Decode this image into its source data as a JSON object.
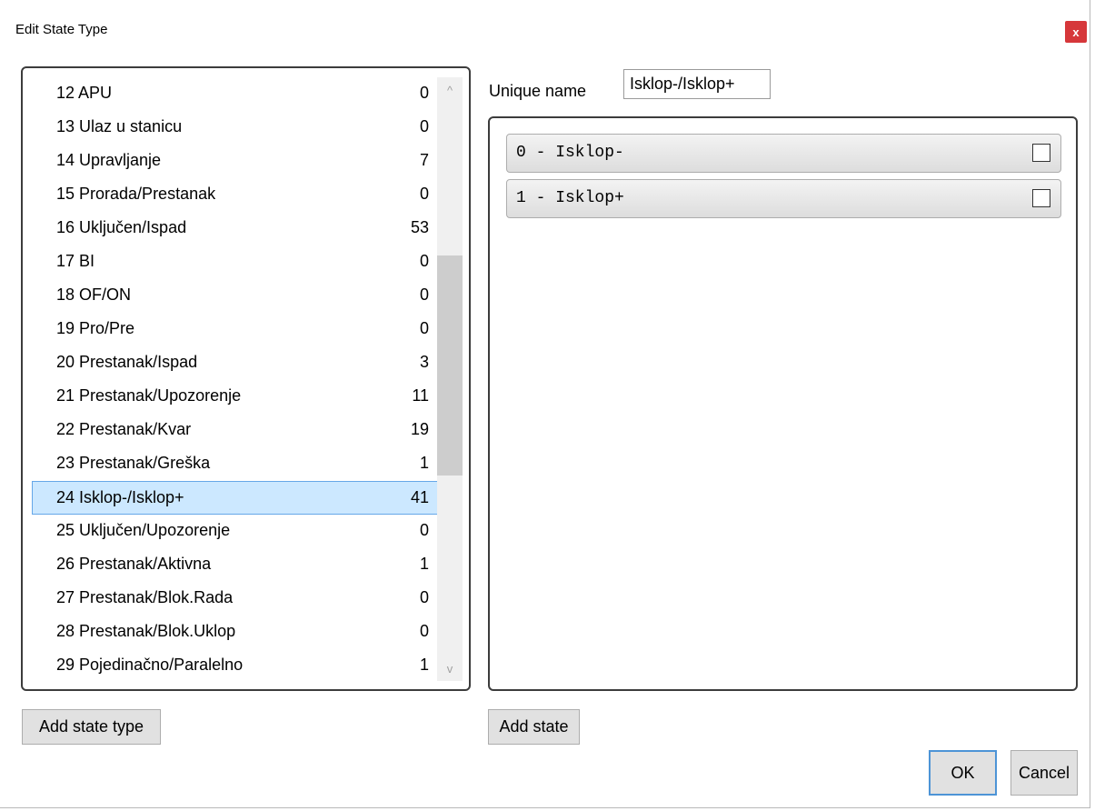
{
  "window": {
    "title": "Edit State Type",
    "close_label": "x"
  },
  "state_types": [
    {
      "label": "12 APU",
      "count": "0"
    },
    {
      "label": "13 Ulaz u stanicu",
      "count": "0"
    },
    {
      "label": "14 Upravljanje",
      "count": "7"
    },
    {
      "label": "15 Prorada/Prestanak",
      "count": "0"
    },
    {
      "label": "16 Uključen/Ispad",
      "count": "53"
    },
    {
      "label": "17 BI",
      "count": "0"
    },
    {
      "label": "18 OF/ON",
      "count": "0"
    },
    {
      "label": "19 Pro/Pre",
      "count": "0"
    },
    {
      "label": "20 Prestanak/Ispad",
      "count": "3"
    },
    {
      "label": "21 Prestanak/Upozorenje",
      "count": "11"
    },
    {
      "label": "22 Prestanak/Kvar",
      "count": "19"
    },
    {
      "label": "23 Prestanak/Greška",
      "count": "1"
    },
    {
      "label": "24 Isklop-/Isklop+",
      "count": "41",
      "selected": true
    },
    {
      "label": "25 Uključen/Upozorenje",
      "count": "0"
    },
    {
      "label": "26 Prestanak/Aktivna",
      "count": "1"
    },
    {
      "label": "27 Prestanak/Blok.Rada",
      "count": "0"
    },
    {
      "label": "28 Prestanak/Blok.Uklop",
      "count": "0"
    },
    {
      "label": "29 Pojedinačno/Paralelno",
      "count": "1"
    }
  ],
  "scrollbar": {
    "up_icon": "chevron-up-icon",
    "down_icon": "chevron-down-icon",
    "up_glyph": "^",
    "down_glyph": "v"
  },
  "unique_name": {
    "label": "Unique name",
    "value": "Isklop-/Isklop+"
  },
  "states": [
    {
      "label": "0 - Isklop-",
      "checked": false
    },
    {
      "label": "1 - Isklop+",
      "checked": false
    }
  ],
  "buttons": {
    "add_state_type": "Add state type",
    "add_state": "Add state",
    "ok": "OK",
    "cancel": "Cancel"
  },
  "colors": {
    "selection_bg": "#cce8ff",
    "selection_border": "#66a7e8",
    "close_bg": "#d6373a",
    "ok_border": "#4d94d6"
  }
}
